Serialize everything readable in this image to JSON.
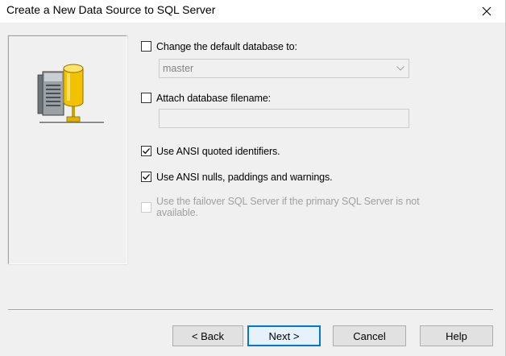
{
  "window": {
    "title": "Create a New Data Source to SQL Server"
  },
  "options": {
    "change_db": {
      "label": "Change the default database to:",
      "checked": false
    },
    "db_combo": {
      "value": "master"
    },
    "attach_db": {
      "label": "Attach database filename:",
      "checked": false
    },
    "ansi_quoted": {
      "label": "Use ANSI quoted identifiers.",
      "checked": true
    },
    "ansi_nulls": {
      "label": "Use ANSI nulls, paddings and warnings.",
      "checked": true
    },
    "failover": {
      "label": "Use the failover SQL Server if the primary SQL Server is not available.",
      "checked": false
    }
  },
  "buttons": {
    "back": "< Back",
    "next": "Next >",
    "cancel": "Cancel",
    "help": "Help"
  },
  "icons": {
    "close": "close-icon",
    "dropdown": "chevron-down-icon",
    "server": "database-server-icon",
    "check": "checkmark-icon"
  },
  "colors": {
    "accent": "#0078d7",
    "dialog_bg": "#f0f0f0",
    "disabled_text": "#a0a0a0"
  }
}
